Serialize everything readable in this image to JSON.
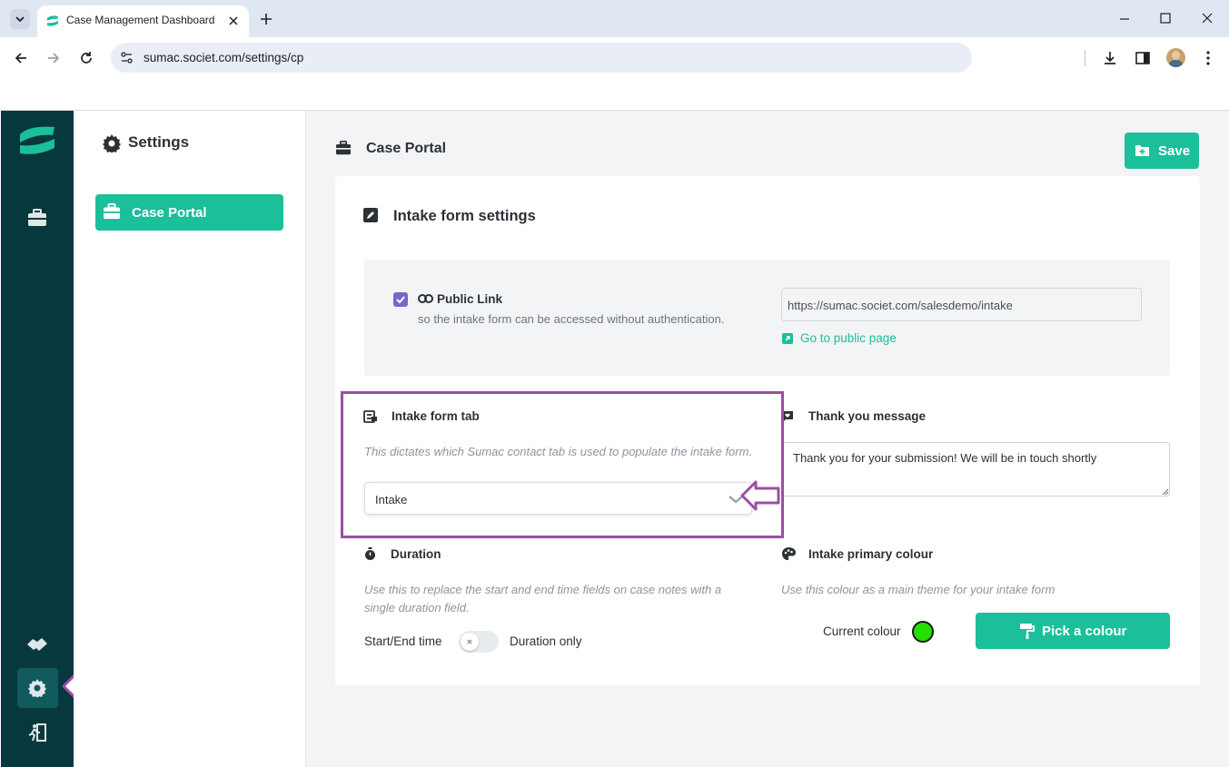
{
  "browser": {
    "tab_title": "Case Management Dashboard",
    "url": "sumac.societ.com/settings/cp"
  },
  "rail": {
    "items": [
      "logo-icon",
      "briefcase-icon",
      "handshake-icon",
      "gear-icon",
      "exit-icon"
    ]
  },
  "settings_nav": {
    "heading": "Settings",
    "items": [
      {
        "label": "Case Portal",
        "active": true
      }
    ]
  },
  "header": {
    "title": "Case Portal",
    "save_label": "Save"
  },
  "intake": {
    "section_title": "Intake form settings",
    "public_link": {
      "checked": true,
      "label": "Public Link",
      "desc": "so the intake form can be accessed without authentication.",
      "url_value": "https://sumac.societ.com/salesdemo/intake",
      "go_label": "Go to public page"
    },
    "tab": {
      "label": "Intake form tab",
      "desc": "This dictates which Sumac contact tab is used to populate the intake form.",
      "value": "Intake"
    },
    "thanks": {
      "label": "Thank you message",
      "value": "Thank you for your submission! We will be in touch shortly"
    },
    "duration": {
      "label": "Duration",
      "desc": "Use this to replace the start and end time fields on case notes with a single duration field.",
      "left_label": "Start/End time",
      "right_label": "Duration only",
      "on": false
    },
    "colour": {
      "label": "Intake primary colour",
      "desc": "Use this colour as a main theme for your intake form",
      "current_label": "Current colour",
      "current_hex": "#22e000",
      "pick_label": "Pick a colour"
    }
  },
  "colors": {
    "accent": "#1bbf9a",
    "rail": "#07383d",
    "annotation": "#9b4fa3",
    "checkbox": "#7a63c9"
  }
}
